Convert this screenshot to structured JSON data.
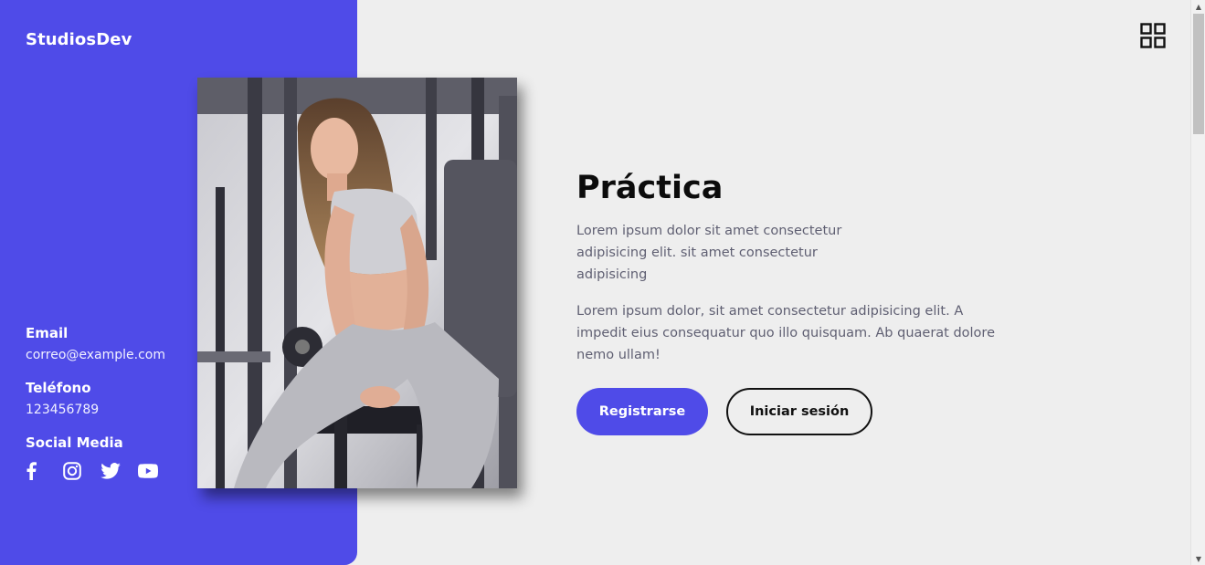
{
  "brand": {
    "name": "StudiosDev"
  },
  "contact": {
    "email_label": "Email",
    "email_value": "correo@example.com",
    "phone_label": "Teléfono",
    "phone_value": "123456789",
    "social_label": "Social Media",
    "social_icons": [
      "facebook-icon",
      "instagram-icon",
      "twitter-icon",
      "youtube-icon"
    ]
  },
  "hero": {
    "title": "Práctica",
    "paragraph_1": "Lorem ipsum dolor sit amet consectetur adipisicing elit. sit amet consectetur adipisicing",
    "paragraph_2": "Lorem ipsum dolor, sit amet consectetur adipisicing elit. A impedit eius consequatur quo illo quisquam. Ab quaerat dolore nemo ullam!",
    "primary_button": "Registrarse",
    "secondary_button": "Iniciar sesión"
  },
  "header": {
    "menu_icon": "grid-icon"
  },
  "colors": {
    "accent": "#4f4be8",
    "background": "#eeeeee",
    "title": "#0c0c0c",
    "body_text": "#5f5f72"
  }
}
